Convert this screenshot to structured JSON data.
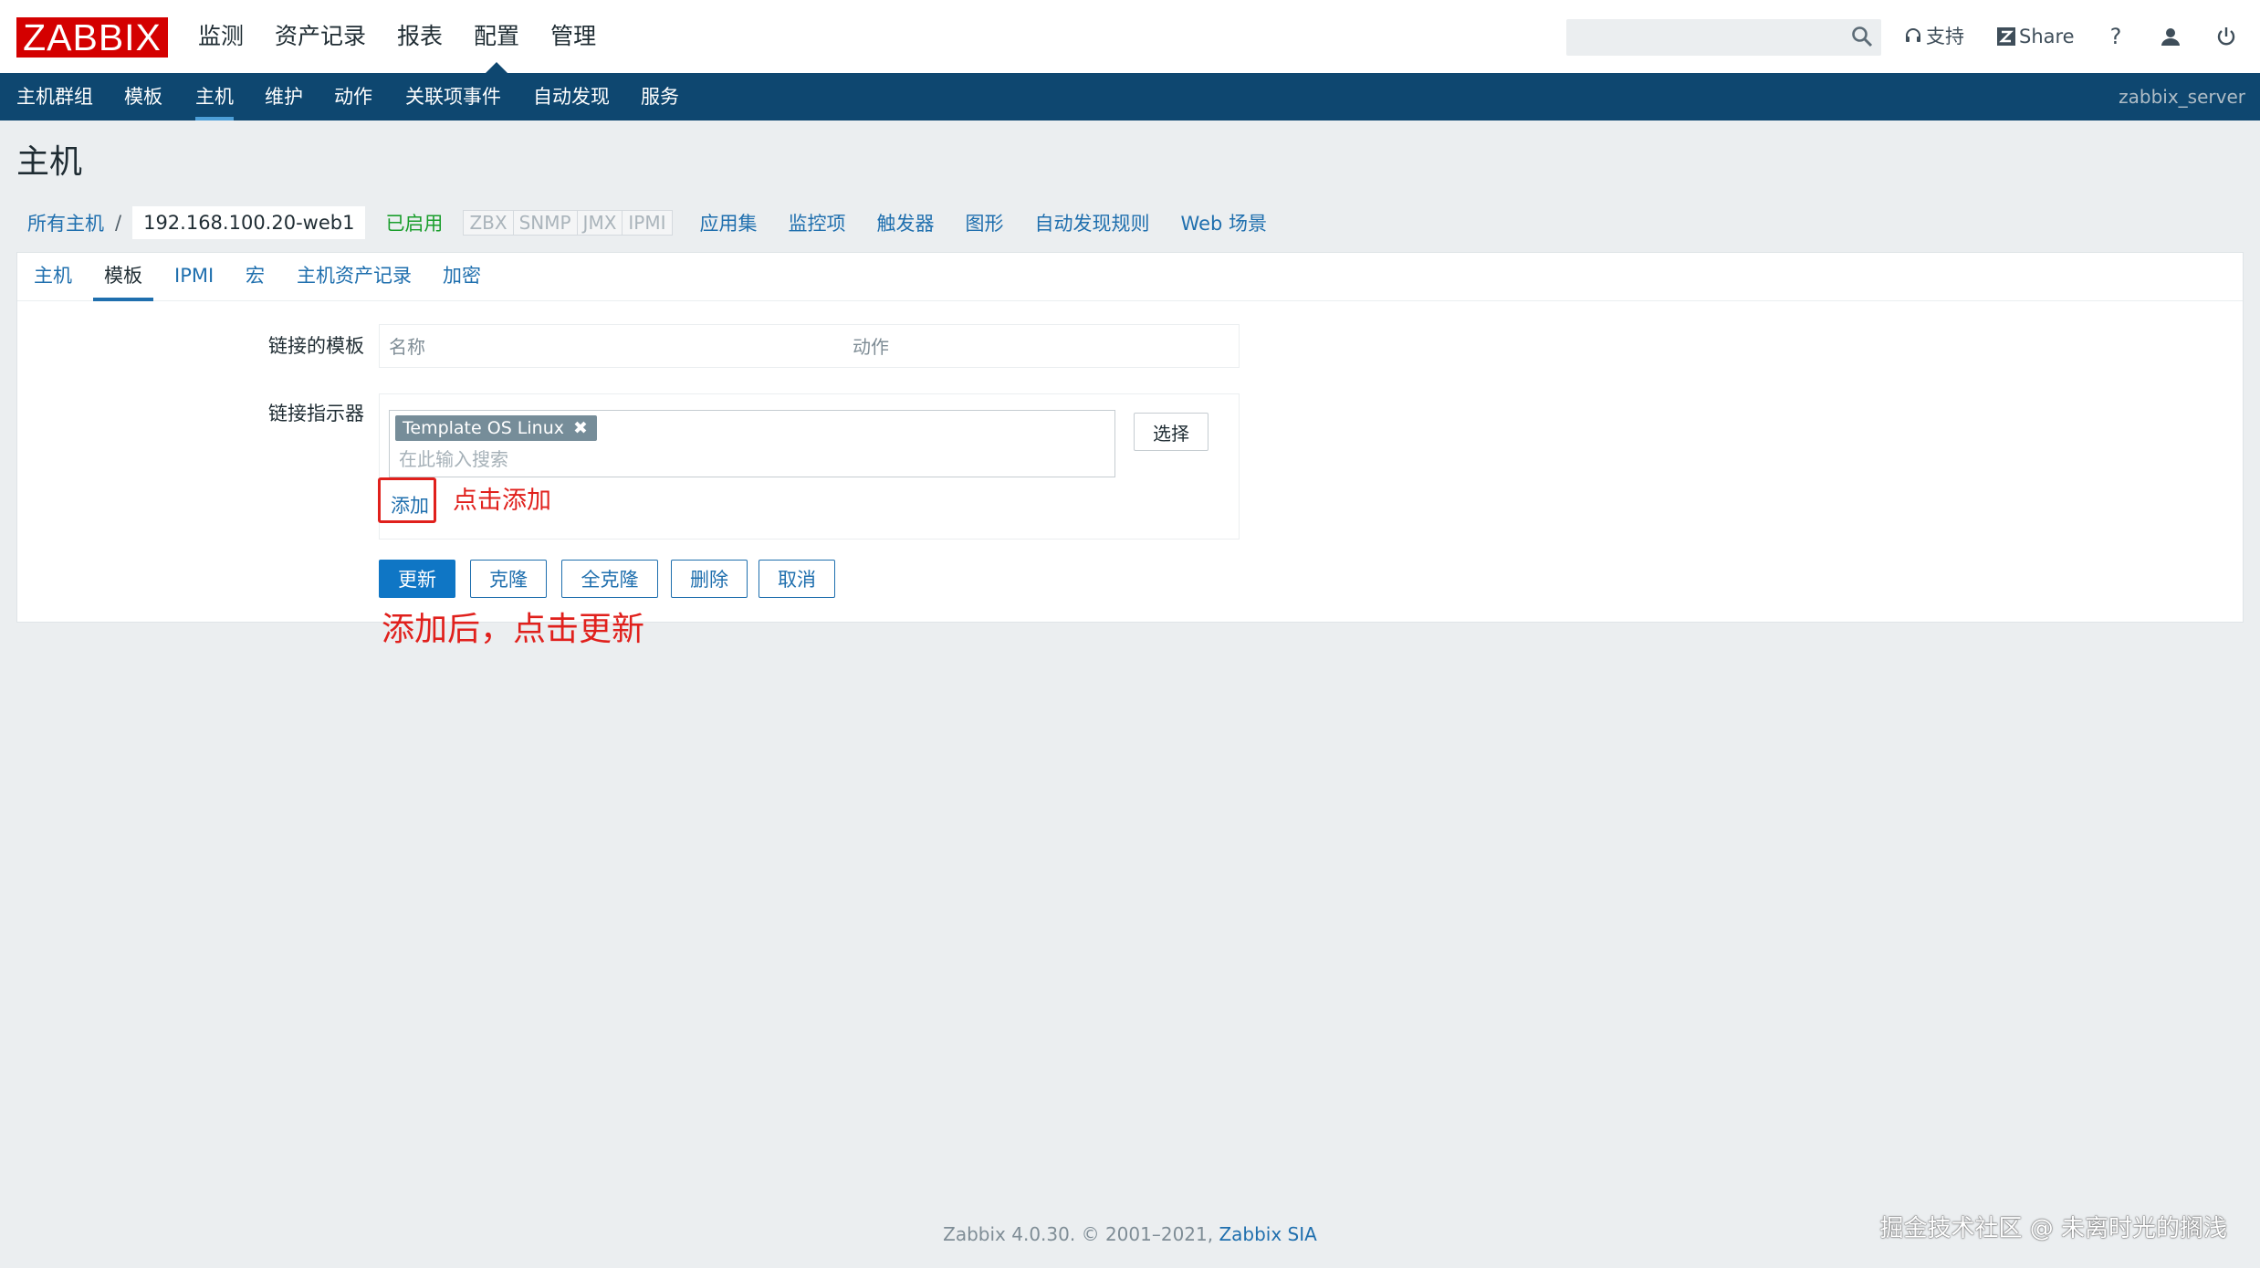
{
  "header": {
    "logo": "ZABBIX",
    "main_nav": [
      "监测",
      "资产记录",
      "报表",
      "配置",
      "管理"
    ],
    "active_main": "配置",
    "search_placeholder": "",
    "support_label": "支持",
    "share_label": "Share",
    "help_label": "?"
  },
  "sub_nav": {
    "items": [
      "主机群组",
      "模板",
      "主机",
      "维护",
      "动作",
      "关联项事件",
      "自动发现",
      "服务"
    ],
    "active": "主机",
    "server_name": "zabbix_server"
  },
  "page": {
    "title": "主机"
  },
  "breadcrumb": {
    "all_hosts": "所有主机",
    "separator": "/",
    "current_host": "192.168.100.20-web1",
    "status": "已启用",
    "availability": [
      "ZBX",
      "SNMP",
      "JMX",
      "IPMI"
    ],
    "links": [
      "应用集",
      "监控项",
      "触发器",
      "图形",
      "自动发现规则",
      "Web 场景"
    ]
  },
  "tabs": {
    "items": [
      "主机",
      "模板",
      "IPMI",
      "宏",
      "主机资产记录",
      "加密"
    ],
    "active": "模板"
  },
  "form": {
    "linked_templates_label": "链接的模板",
    "linked_table_headers": [
      "名称",
      "动作"
    ],
    "link_new_label": "链接指示器",
    "selected_template": "Template OS Linux",
    "remove_symbol": "✖",
    "search_placeholder": "在此输入搜索",
    "select_button": "选择",
    "add_link": "添加"
  },
  "buttons": {
    "update": "更新",
    "clone": "克隆",
    "full_clone": "全克隆",
    "delete": "删除",
    "cancel": "取消"
  },
  "annotations": {
    "click_add": "点击添加",
    "after_add": "添加后，点击更新"
  },
  "footer": {
    "text": "Zabbix 4.0.30. © 2001–2021, ",
    "link": "Zabbix SIA"
  },
  "watermark": "掘金技术社区 @ 未离时光的搁浅",
  "colors": {
    "brand_red": "#d40000",
    "nav_blue": "#0e4770",
    "link_blue": "#1f6fae",
    "primary_button": "#0f76c5",
    "enabled_green": "#1a9e2c",
    "annotation_red": "#e0201c"
  }
}
